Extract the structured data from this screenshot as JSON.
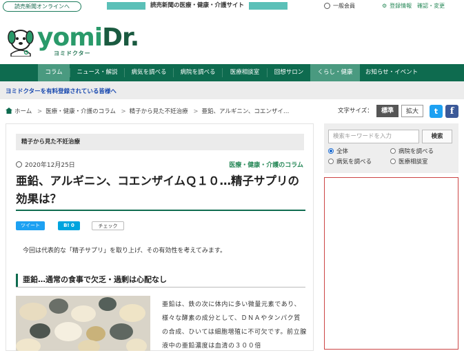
{
  "topbar": {
    "online_button": "読売新聞オンラインへ",
    "yomiuri_banner": "読売新聞の医療・健康・介護サイト",
    "member_label": "一般会員",
    "account_label": "登録情報　確認・変更"
  },
  "logo": {
    "word_a": "yomi",
    "word_b": "Dr.",
    "kana": "ヨミドクター"
  },
  "nav": {
    "items": [
      {
        "label": "コラム",
        "active": true
      },
      {
        "label": "ニュース・解説",
        "active": false
      },
      {
        "label": "病気を調べる",
        "active": false
      },
      {
        "label": "病院を調べる",
        "active": false
      },
      {
        "label": "医療相談室",
        "active": false
      },
      {
        "label": "回想サロン",
        "active": false
      },
      {
        "label": "くらし・健康",
        "active": true
      },
      {
        "label": "お知らせ・イベント",
        "active": false
      }
    ]
  },
  "subbar": {
    "link": "ヨミドクターを有料登録されている皆様へ"
  },
  "breadcrumb": {
    "home": "ホーム",
    "items": [
      "医療・健康・介護のコラム",
      "精子から見た不妊治療",
      "亜鉛、アルギニン、コエンザイ…"
    ]
  },
  "font_size": {
    "label": "文字サイズ：",
    "standard": "標準",
    "large": "拡大"
  },
  "social": {
    "twitter": "t",
    "facebook": "f"
  },
  "article": {
    "series": "精子から見た不妊治療",
    "date": "2020年12月25日",
    "category": "医療・健康・介護のコラム",
    "title": "亜鉛、アルギニン、コエンザイムＱ１０…精子サプリの効果は？",
    "share": {
      "tweet": "ツイート",
      "hatena": "B! 0",
      "check": "チェック"
    },
    "lead": "今回は代表的な「精子サプリ」を取り上げ、その有効性を考えてみます。",
    "heading": "亜鉛…通常の食事で欠乏・過剰は心配なし",
    "body": "亜鉛は、鉄の次に体内に多い微量元素であり、様々な酵素の成分として、ＤＮＡやタンパク質の合成、ひいては細胞増殖に不可欠です。前立腺液中の亜鉛濃度は血清の３００倍"
  },
  "sidebar": {
    "search_placeholder": "検索キーワードを入力",
    "search_button": "検索",
    "radios": [
      {
        "label": "全体",
        "checked": true
      },
      {
        "label": "病院を調べる",
        "checked": false
      },
      {
        "label": "病気を調べる",
        "checked": false
      },
      {
        "label": "医療相談室",
        "checked": false
      }
    ]
  }
}
